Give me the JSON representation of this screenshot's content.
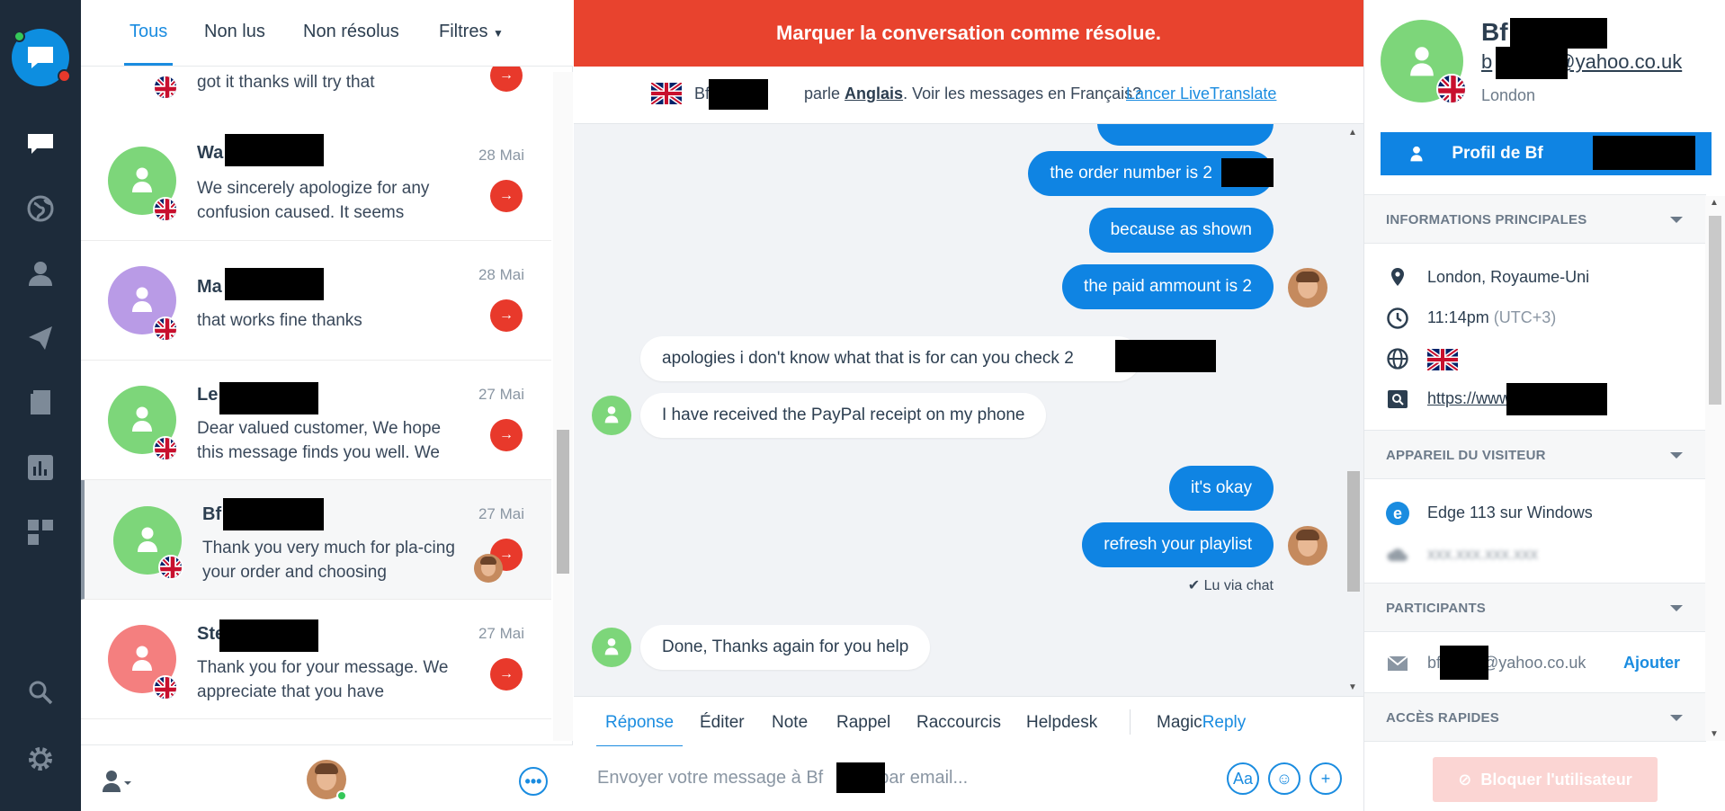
{
  "tabs": {
    "all": "Tous",
    "unread": "Non lus",
    "unresolved": "Non résolus",
    "filters": "Filtres"
  },
  "conversations": [
    {
      "name": "",
      "date": "",
      "message": "got it thanks will try that",
      "avatar_color": "#5fc3f2"
    },
    {
      "name": "Wa",
      "date": "28 Mai",
      "message": "We sincerely apologize for any confusion caused. It seems",
      "avatar_color": "#7dd67a"
    },
    {
      "name": "Ma",
      "date": "28 Mai",
      "message": "that works fine thanks",
      "avatar_color": "#b99be6"
    },
    {
      "name": "Le",
      "date": "27 Mai",
      "message": "Dear valued customer, We hope this message finds you well. We",
      "avatar_color": "#7dd67a"
    },
    {
      "name": "Bf",
      "date": "27 Mai",
      "message": "Thank you very much for pla-cing your order and choosing",
      "avatar_color": "#7dd67a"
    },
    {
      "name": "Ste",
      "date": "27 Mai",
      "message": "Thank you for your message. We appreciate that you have",
      "avatar_color": "#f47f7f"
    }
  ],
  "chat": {
    "resolve_label": "Marquer la conversation comme résolue.",
    "lang_name_prefix": "Bf",
    "lang_text": "parle",
    "lang_value": "Anglais",
    "lang_question": ". Voir les messages en Français?",
    "lang_link": "Lancer LiveTranslate",
    "messages": [
      {
        "dir": "out",
        "text": "the order number is 2"
      },
      {
        "dir": "out",
        "text": "because as shown"
      },
      {
        "dir": "out",
        "text": "the paid ammount is 2"
      },
      {
        "dir": "in",
        "text": "apologies i don't know what that is for can you check 2"
      },
      {
        "dir": "in",
        "text": "I have received the PayPal receipt on my phone"
      },
      {
        "dir": "out",
        "text": "it's okay"
      },
      {
        "dir": "out",
        "text": "refresh your playlist"
      },
      {
        "dir": "in",
        "text": "Done, Thanks again for you help"
      }
    ],
    "read_receipt": "Lu via chat",
    "reply_tabs": [
      "Réponse",
      "Éditer",
      "Note",
      "Rappel",
      "Raccourcis",
      "Helpdesk"
    ],
    "magic_a": "Magic",
    "magic_b": "Reply",
    "compose_placeholder_a": "Envoyer votre message à Bf",
    "compose_placeholder_b": "par email...",
    "compose_font_button": "Aa"
  },
  "visitor": {
    "name": "Bf",
    "email_prefix": "b",
    "email_domain": "@yahoo.co.uk",
    "city": "London",
    "profile_button": "Profil de Bf",
    "sections": {
      "main": "INFORMATIONS PRINCIPALES",
      "device": "APPAREIL DU VISITEUR",
      "participants": "PARTICIPANTS",
      "quick": "ACCÈS RAPIDES"
    },
    "location": "London, Royaume-Uni",
    "time": "11:14pm",
    "timezone": "(UTC+3)",
    "website": "https://www",
    "browser": "Edge 113 sur Windows",
    "ip": "xxx.xxx.xxx.xxx",
    "participant_prefix": "bf",
    "participant_domain": "@yahoo.co.uk",
    "add_label": "Ajouter",
    "block_label": "Bloquer l'utilisateur"
  },
  "colors": {
    "accent": "#0f84e3",
    "resolve": "#e8432e",
    "nav": "#1d2b3a"
  }
}
